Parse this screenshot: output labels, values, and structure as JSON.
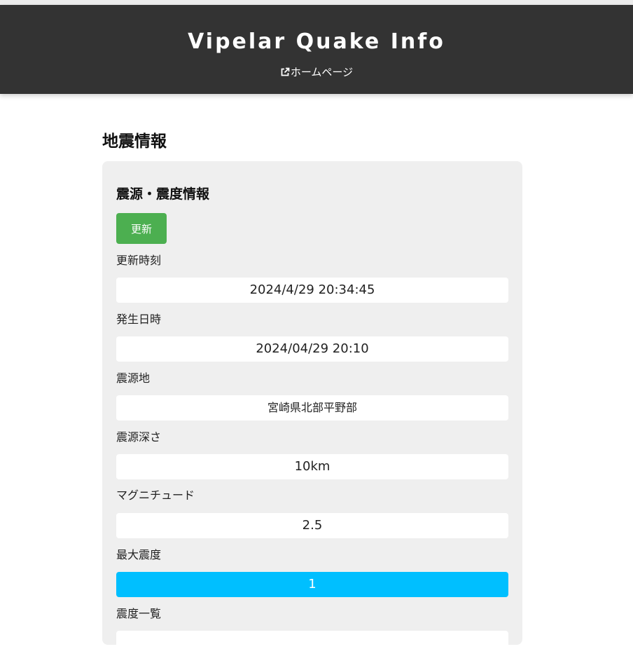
{
  "header": {
    "site_title": "Vipelar Quake Info",
    "home_link_label": "ホームページ",
    "home_link_icon": "external-link-icon"
  },
  "main": {
    "section_title": "地震情報",
    "card": {
      "title": "震源・震度情報",
      "refresh_button_label": "更新",
      "refresh_button_color": "#4caf50",
      "fields": {
        "updated_at": {
          "label": "更新時刻",
          "value": "2024/4/29 20:34:45"
        },
        "occurred_at": {
          "label": "発生日時",
          "value": "2024/04/29 20:10"
        },
        "epicenter": {
          "label": "震源地",
          "value": "宮崎県北部平野部"
        },
        "depth": {
          "label": "震源深さ",
          "value": "10km"
        },
        "magnitude": {
          "label": "マグニチュード",
          "value": "2.5"
        },
        "max_intensity": {
          "label": "最大震度",
          "value": "1",
          "color": "#00bfff"
        },
        "intensity_list": {
          "label": "震度一覧"
        }
      }
    }
  }
}
